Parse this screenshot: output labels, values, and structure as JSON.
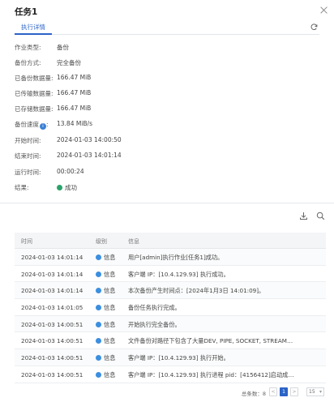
{
  "dialog": {
    "title": "任务1"
  },
  "tabs": [
    {
      "label": "执行详情"
    }
  ],
  "details": [
    {
      "label": "作业类型:",
      "value": "备份"
    },
    {
      "label": "备份方式:",
      "value": "完全备份"
    },
    {
      "label": "已备份数据量:",
      "value": "166.47 MiB"
    },
    {
      "label": "已传输数据量:",
      "value": "166.47 MiB"
    },
    {
      "label": "已存储数据量:",
      "value": "166.47 MiB"
    },
    {
      "label": "备份速度",
      "value": "13.84 MiB/s"
    },
    {
      "label": "开始时间:",
      "value": "2024-01-03 14:00:50"
    },
    {
      "label": "结束时间:",
      "value": "2024-01-03 14:01:14"
    },
    {
      "label": "运行时间:",
      "value": "00:00:24"
    },
    {
      "label": "结果:",
      "value": "成功"
    }
  ],
  "speed_info_icon": "i",
  "table": {
    "headers": [
      "时间",
      "级别",
      "信息"
    ],
    "rows": [
      {
        "time": "2024-01-03 14:01:14",
        "level": "信息",
        "msg": "用户[admin]执行作业[任务1]成功。"
      },
      {
        "time": "2024-01-03 14:01:14",
        "level": "信息",
        "msg": "客户端 IP：[10.4.129.93] 执行成功。"
      },
      {
        "time": "2024-01-03 14:01:14",
        "level": "信息",
        "msg": "本次备份产生时间点：[2024年1月3日 14:01:09]。"
      },
      {
        "time": "2024-01-03 14:01:05",
        "level": "信息",
        "msg": "备份任务执行完成。"
      },
      {
        "time": "2024-01-03 14:00:51",
        "level": "信息",
        "msg": "开始执行完全备份。"
      },
      {
        "time": "2024-01-03 14:00:51",
        "level": "信息",
        "msg": "文件备份对路径下包含了大量DEV, PIPE, SOCKET, STREAM…"
      },
      {
        "time": "2024-01-03 14:00:51",
        "level": "信息",
        "msg": "客户端 IP：[10.4.129.93] 执行开始。"
      },
      {
        "time": "2024-01-03 14:00:51",
        "level": "信息",
        "msg": "客户端 IP：[10.4.129.93] 执行进程 pid：[4156412]启动成…"
      }
    ]
  },
  "pager": {
    "total_label": "总条数：8",
    "prev": "<",
    "page": "1",
    "next": ">",
    "page_size": "15"
  },
  "colors": {
    "accent": "#2b63c7",
    "success": "#29a36a",
    "info": "#3b8fe0"
  }
}
